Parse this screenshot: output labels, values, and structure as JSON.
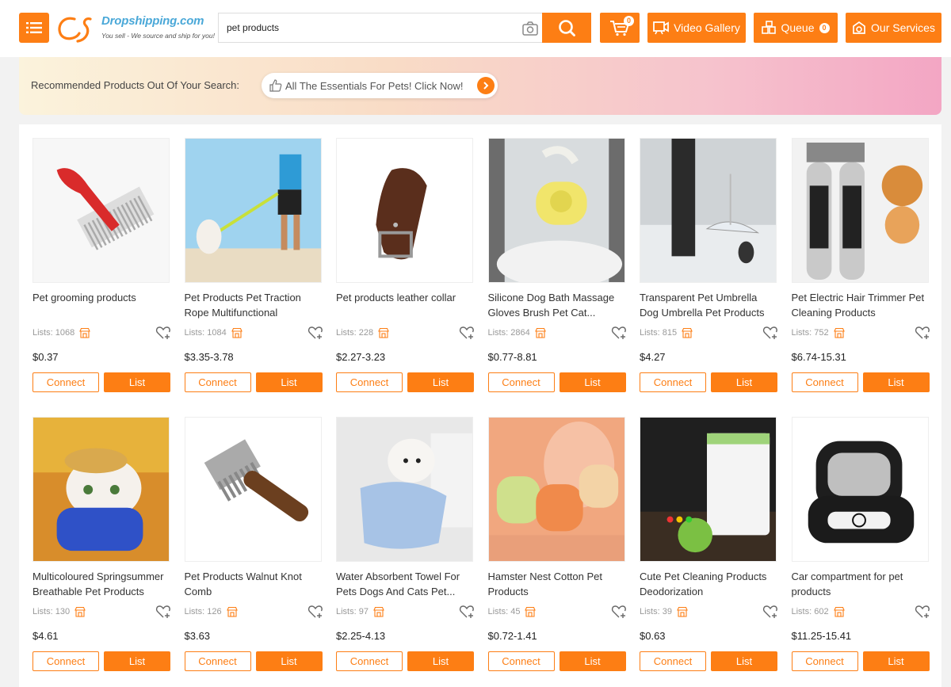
{
  "header": {
    "logo_name": "Dropshipping.com",
    "logo_tagline": "You sell - We source and ship for you!",
    "search_value": "pet products",
    "cart_count": "0",
    "video_label": "Video Gallery",
    "queue_label": "Queue",
    "queue_count": "0",
    "services_label": "Our Services",
    "accent_color": "#fd7e14"
  },
  "banner": {
    "label": "Recommended Products Out Of Your Search:",
    "pill_text": "All The Essentials For Pets! Click Now!"
  },
  "buttons": {
    "connect": "Connect",
    "list": "List"
  },
  "products": [
    {
      "title": "Pet grooming products",
      "lists": "Lists: 1068",
      "price": "$0.37",
      "image": "comb"
    },
    {
      "title": "Pet Products Pet Traction Rope Multifunctional",
      "lists": "Lists: 1084",
      "price": "$3.35-3.78",
      "image": "runner"
    },
    {
      "title": "Pet products leather collar",
      "lists": "Lists: 228",
      "price": "$2.27-3.23",
      "image": "collar"
    },
    {
      "title": "Silicone Dog Bath Massage Gloves Brush Pet Cat...",
      "lists": "Lists: 2864",
      "price": "$0.77-8.81",
      "image": "bath"
    },
    {
      "title": "Transparent Pet Umbrella Dog Umbrella Pet Products",
      "lists": "Lists: 815",
      "price": "$4.27",
      "image": "umbrella"
    },
    {
      "title": "Pet Electric Hair Trimmer Pet Cleaning Products",
      "lists": "Lists: 752",
      "price": "$6.74-15.31",
      "image": "trimmer"
    },
    {
      "title": "Multicoloured Springsummer Breathable Pet Products",
      "lists": "Lists: 130",
      "price": "$4.61",
      "image": "cat"
    },
    {
      "title": "Pet Products Walnut Knot Comb",
      "lists": "Lists: 126",
      "price": "$3.63",
      "image": "knotcomb"
    },
    {
      "title": "Water Absorbent Towel For Pets Dogs And Cats Pet...",
      "lists": "Lists: 97",
      "price": "$2.25-4.13",
      "image": "towel"
    },
    {
      "title": "Hamster Nest Cotton Pet Products",
      "lists": "Lists: 45",
      "price": "$0.72-1.41",
      "image": "hamster"
    },
    {
      "title": "Cute Pet Cleaning Products Deodorization",
      "lists": "Lists: 39",
      "price": "$0.63",
      "image": "deodor"
    },
    {
      "title": "Car compartment for pet products",
      "lists": "Lists: 602",
      "price": "$11.25-15.41",
      "image": "carbed"
    }
  ]
}
